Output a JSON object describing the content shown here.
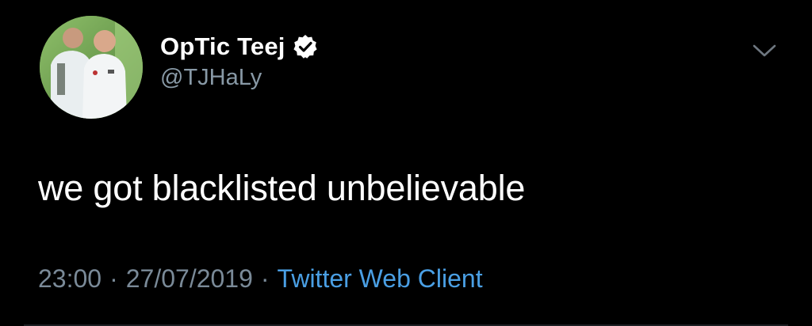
{
  "tweet": {
    "author": {
      "display_name": "OpTic Teej",
      "handle": "@TJHaLy",
      "verified": true,
      "avatar_icon": "profile-photo"
    },
    "text": "we got blacklisted unbelievable",
    "time": "23:00",
    "date": "27/07/2019",
    "separator": "·",
    "client": "Twitter Web Client",
    "menu_icon": "chevron-down-icon"
  },
  "colors": {
    "background": "#000000",
    "primary_text": "#ffffff",
    "secondary_text": "#8899a6",
    "link": "#4a9fe4",
    "verified_badge": "#ffffff"
  }
}
